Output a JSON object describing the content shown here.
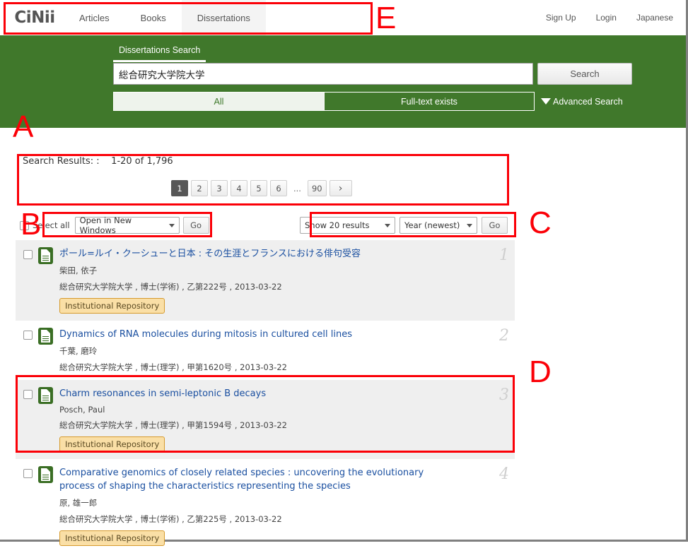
{
  "header": {
    "logo": "CiNii",
    "tabs": [
      {
        "label": "Articles",
        "active": false
      },
      {
        "label": "Books",
        "active": false
      },
      {
        "label": "Dissertations",
        "active": true
      }
    ],
    "sign_up": "Sign Up",
    "login": "Login",
    "language": "Japanese"
  },
  "search": {
    "tab_label": "Dissertations Search",
    "query_value": "総合研究大学院大学",
    "search_button": "Search",
    "filter_all": "All",
    "filter_fulltext": "Full-text exists",
    "advanced_search": "Advanced Search"
  },
  "results_header": {
    "label": "Search Results: :",
    "range": "1-20 of 1,796",
    "pages": [
      "1",
      "2",
      "3",
      "4",
      "5",
      "6"
    ],
    "ellipsis": "...",
    "last_page": "90",
    "next_glyph": "›",
    "active_page": "1"
  },
  "toolbar": {
    "select_all_label": "Select all",
    "action_select": "Open in New Windows",
    "go_left": "Go",
    "count_select": "Show 20 results",
    "sort_select": "Year (newest)",
    "go_right": "Go"
  },
  "results": [
    {
      "number": "1",
      "title": "ポール=ルイ・クーシューと日本 : その生涯とフランスにおける俳句受容",
      "author": "柴田, 依子",
      "meta": "総合研究大学院大学 , 博士(学術) , 乙第222号 , 2013-03-22",
      "badge": "Institutional Repository",
      "shaded": true
    },
    {
      "number": "2",
      "title": "Dynamics of RNA molecules during mitosis in cultured cell lines",
      "author": "千葉, 磨玲",
      "meta": "総合研究大学院大学 , 博士(理学) , 甲第1620号 , 2013-03-22",
      "badge": "",
      "shaded": false
    },
    {
      "number": "3",
      "title": "Charm resonances in semi-leptonic B decays",
      "author": "Posch, Paul",
      "meta": "総合研究大学院大学 , 博士(理学) , 甲第1594号 , 2013-03-22",
      "badge": "Institutional Repository",
      "shaded": true
    },
    {
      "number": "4",
      "title": "Comparative genomics of closely related species : uncovering the evolutionary process of shaping the characteristics representing the species",
      "author": "原, 雄一郎",
      "meta": "総合研究大学院大学 , 博士(学術) , 乙第225号 , 2013-03-22",
      "badge": "Institutional Repository",
      "shaded": false
    }
  ],
  "annotations": [
    {
      "letter": "A"
    },
    {
      "letter": "B"
    },
    {
      "letter": "C"
    },
    {
      "letter": "D"
    },
    {
      "letter": "E"
    }
  ],
  "colors": {
    "brand_green": "#40782b",
    "link_blue": "#1a4fa0",
    "annotation_red": "#fb0007",
    "badge_bg": "#fadfa6"
  }
}
